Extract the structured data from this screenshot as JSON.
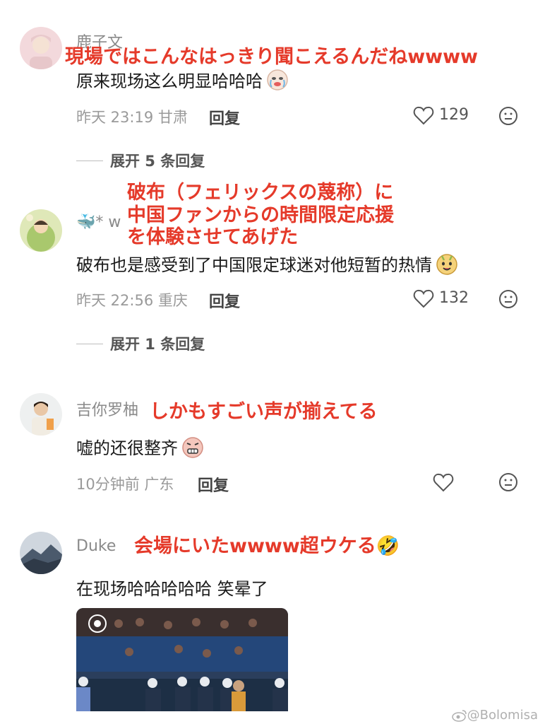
{
  "comments": [
    {
      "username": "鹿子文",
      "text": "原来现场这么明显哈哈哈",
      "time": "昨天 23:19",
      "location": "甘肃",
      "reply": "回复",
      "likes": "129",
      "expand": "展开 5 条回复",
      "overlay": "現場ではこんなはっきり聞こえるんだねwwww"
    },
    {
      "username": "🐳* w",
      "text": "破布也是感受到了中国限定球迷对他短暂的热情",
      "time": "昨天 22:56",
      "location": "重庆",
      "reply": "回复",
      "likes": "132",
      "expand": "展开 1 条回复",
      "overlay_lines": [
        "破布（フェリックスの蔑称）に",
        "中国ファンからの時間限定応援",
        "を体験させてあげた"
      ]
    },
    {
      "username": "吉你罗柚",
      "text": "嘘的还很整齐",
      "time": "10分钟前",
      "location": "广东",
      "reply": "回复",
      "overlay": "しかもすごい声が揃えてる"
    },
    {
      "username": "Duke",
      "text": "在现场哈哈哈哈哈 笑晕了",
      "overlay": "会場にいたwwww超ウケる🤣"
    }
  ],
  "watermark": "@Bolomisa",
  "colors": {
    "overlay": "#e53a2a",
    "meta": "#9a9a9a"
  },
  "icons": [
    "heart-icon",
    "face-icon",
    "weibo-icon"
  ]
}
